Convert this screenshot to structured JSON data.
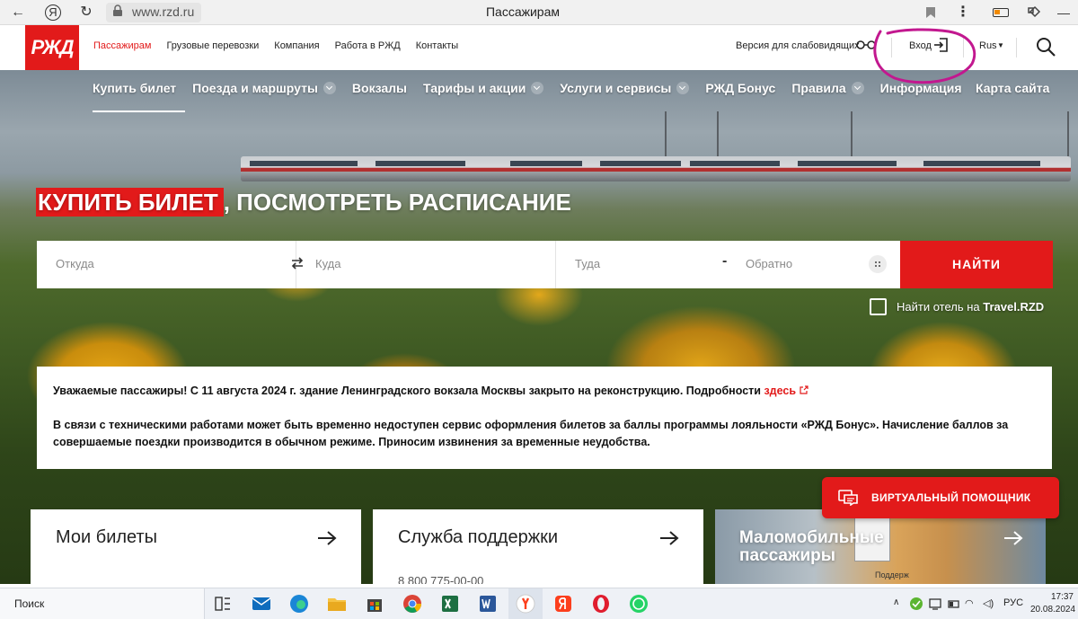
{
  "browser": {
    "url": "www.rzd.ru",
    "page_title": "Пассажирам"
  },
  "header": {
    "logo": "РЖД",
    "top_nav": [
      "Пассажирам",
      "Грузовые перевозки",
      "Компания",
      "Работа в РЖД",
      "Контакты"
    ],
    "accessibility": "Версия для слабовидящих",
    "login": "Вход",
    "language": "Rus"
  },
  "main_nav": {
    "items": [
      {
        "label": "Купить билет",
        "dropdown": false
      },
      {
        "label": "Поезда и маршруты",
        "dropdown": true
      },
      {
        "label": "Вокзалы",
        "dropdown": false
      },
      {
        "label": "Тарифы и акции",
        "dropdown": true
      },
      {
        "label": "Услуги и сервисы",
        "dropdown": true
      },
      {
        "label": "РЖД Бонус",
        "dropdown": false
      },
      {
        "label": "Правила",
        "dropdown": true
      },
      {
        "label": "Информация",
        "dropdown": false
      }
    ],
    "sitemap": "Карта сайта"
  },
  "hero": {
    "title_highlight": "КУПИТЬ БИЛЕТ",
    "title_rest": ", ПОСМОТРЕТЬ РАСПИСАНИЕ"
  },
  "search": {
    "from_placeholder": "Откуда",
    "to_placeholder": "Куда",
    "depart_placeholder": "Туда",
    "dash": "-",
    "return_placeholder": "Обратно",
    "button": "НАЙТИ",
    "hotel_label": "Найти отель на ",
    "hotel_brand": "Travel.RZD"
  },
  "notice": {
    "p1_text": "Уважаемые пассажиры! С 11 августа 2024 г. здание Ленинградского вокзала Москвы закрыто на реконструкцию. Подробности ",
    "p1_link": "здесь",
    "p2": "В связи с техническими работами может быть временно недоступен сервис оформления билетов за баллы программы лояльности «РЖД Бонус». Начисление баллов за совершаемые поездки производится в обычном режиме. Приносим извинения за временные неудобства."
  },
  "cards": {
    "tickets": "Мои билеты",
    "support": "Служба поддержки",
    "support_phone": "8 800 775-00-00",
    "mobility": "Маломобильные пассажиры",
    "mobility_sign": "Поддерж"
  },
  "assistant": {
    "label": "ВИРТУАЛЬНЫЙ ПОМОЩНИК"
  },
  "taskbar": {
    "search": "Поиск",
    "lang": "РУС",
    "time": "17:37",
    "date": "20.08.2024"
  },
  "colors": {
    "brand_red": "#e21a1a",
    "annotation_purple": "#c2188f"
  }
}
